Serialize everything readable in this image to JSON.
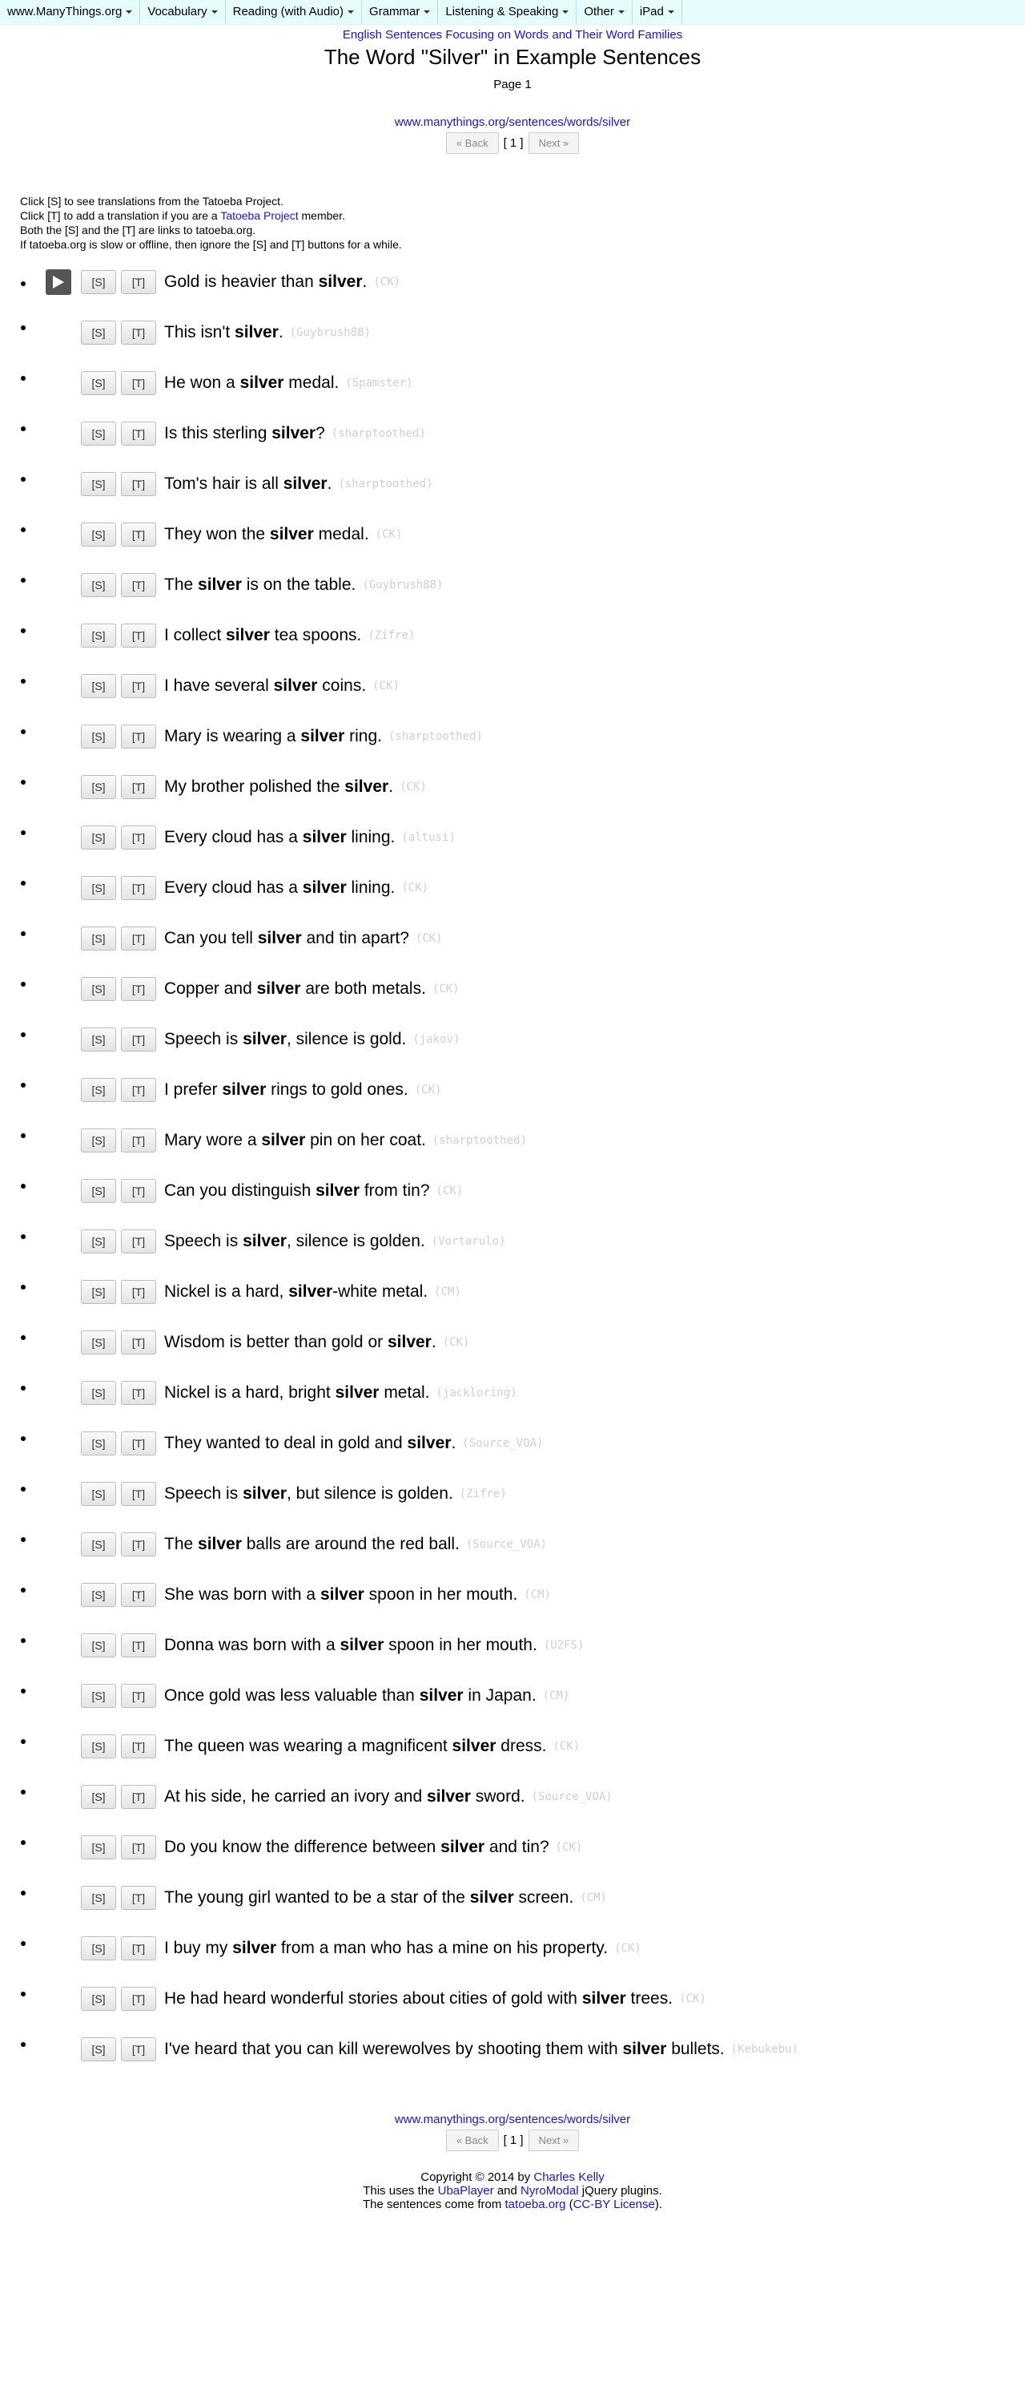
{
  "nav": {
    "items": [
      "www.ManyThings.org",
      "Vocabulary",
      "Reading (with Audio)",
      "Grammar",
      "Listening & Speaking",
      "Other",
      "iPad"
    ]
  },
  "header": {
    "subtitle": "English Sentences Focusing on Words and Their Word Families",
    "title": "The Word \"Silver\" in Example Sentences",
    "page": "Page 1",
    "url": "www.manythings.org/sentences/words/silver"
  },
  "pager": {
    "back": "« Back",
    "current": "[ 1 ]",
    "next": "Next »"
  },
  "notes": {
    "line1": "Click [S] to see translations from the Tatoeba Project.",
    "line2_pre": "Click [T] to add a translation if you are a ",
    "line2_link": "Tatoeba Project",
    "line2_post": " member.",
    "line3": "Both the [S] and the [T] are links to tatoeba.org.",
    "line4": "If tatoeba.org is slow or offline, then ignore the [S] and [T] buttons for a while."
  },
  "buttons": {
    "s": "[S]",
    "t": "[T]"
  },
  "sentences": [
    {
      "pre": "Gold is heavier than ",
      "word": "silver",
      "post": ".",
      "by": "(CK)"
    },
    {
      "pre": "This isn't ",
      "word": "silver",
      "post": ".",
      "by": "(Guybrush88)"
    },
    {
      "pre": "He won a ",
      "word": "silver",
      "post": " medal.",
      "by": "(Spamster)"
    },
    {
      "pre": "Is this sterling ",
      "word": "silver",
      "post": "?",
      "by": "(sharptoothed)"
    },
    {
      "pre": "Tom's hair is all ",
      "word": "silver",
      "post": ".",
      "by": "(sharptoothed)"
    },
    {
      "pre": "They won the ",
      "word": "silver",
      "post": " medal.",
      "by": "(CK)"
    },
    {
      "pre": "The ",
      "word": "silver",
      "post": " is on the table.",
      "by": "(Guybrush88)"
    },
    {
      "pre": "I collect ",
      "word": "silver",
      "post": " tea spoons.",
      "by": "(Zifre)"
    },
    {
      "pre": "I have several ",
      "word": "silver",
      "post": " coins.",
      "by": "(CK)"
    },
    {
      "pre": "Mary is wearing a ",
      "word": "silver",
      "post": " ring.",
      "by": "(sharptoothed)"
    },
    {
      "pre": "My brother polished the ",
      "word": "silver",
      "post": ".",
      "by": "(CK)"
    },
    {
      "pre": "Every cloud has a ",
      "word": "silver",
      "post": " lining.",
      "by": "(altusi)"
    },
    {
      "pre": "Every cloud has a ",
      "word": "silver",
      "post": " lining.",
      "by": "(CK)"
    },
    {
      "pre": "Can you tell ",
      "word": "silver",
      "post": " and tin apart?",
      "by": "(CK)"
    },
    {
      "pre": "Copper and ",
      "word": "silver",
      "post": " are both metals.",
      "by": "(CK)"
    },
    {
      "pre": "Speech is ",
      "word": "silver",
      "post": ", silence is gold.",
      "by": "(jakov)"
    },
    {
      "pre": "I prefer ",
      "word": "silver",
      "post": " rings to gold ones.",
      "by": "(CK)"
    },
    {
      "pre": "Mary wore a ",
      "word": "silver",
      "post": " pin on her coat.",
      "by": "(sharptoothed)"
    },
    {
      "pre": "Can you distinguish ",
      "word": "silver",
      "post": " from tin?",
      "by": "(CK)"
    },
    {
      "pre": "Speech is ",
      "word": "silver",
      "post": ", silence is golden.",
      "by": "(Vortarulo)"
    },
    {
      "pre": "Nickel is a hard, ",
      "word": "silver",
      "post": "-white metal.",
      "by": "(CM)"
    },
    {
      "pre": "Wisdom is better than gold or ",
      "word": "silver",
      "post": ".",
      "by": "(CK)"
    },
    {
      "pre": "Nickel is a hard, bright ",
      "word": "silver",
      "post": " metal.",
      "by": "(jackloring)"
    },
    {
      "pre": "They wanted to deal in gold and ",
      "word": "silver",
      "post": ".",
      "by": "(Source_VOA)"
    },
    {
      "pre": "Speech is ",
      "word": "silver",
      "post": ", but silence is golden.",
      "by": "(Zifre)"
    },
    {
      "pre": "The ",
      "word": "silver",
      "post": " balls are around the red ball.",
      "by": "(Source_VOA)"
    },
    {
      "pre": "She was born with a ",
      "word": "silver",
      "post": " spoon in her mouth.",
      "by": "(CM)"
    },
    {
      "pre": "Donna was born with a ",
      "word": "silver",
      "post": " spoon in her mouth.",
      "by": "(U2FS)"
    },
    {
      "pre": "Once gold was less valuable than ",
      "word": "silver",
      "post": " in Japan.",
      "by": "(CM)"
    },
    {
      "pre": "The queen was wearing a magnificent ",
      "word": "silver",
      "post": " dress.",
      "by": "(CK)"
    },
    {
      "pre": "At his side, he carried an ivory and ",
      "word": "silver",
      "post": " sword.",
      "by": "(Source_VOA)"
    },
    {
      "pre": "Do you know the difference between ",
      "word": "silver",
      "post": " and tin?",
      "by": "(CK)"
    },
    {
      "pre": "The young girl wanted to be a star of the ",
      "word": "silver",
      "post": " screen.",
      "by": "(CM)"
    },
    {
      "pre": "I buy my ",
      "word": "silver",
      "post": " from a man who has a mine on his property.",
      "by": "(CK)"
    },
    {
      "pre": "He had heard wonderful stories about cities of gold with ",
      "word": "silver",
      "post": " trees.",
      "by": "(CK)"
    },
    {
      "pre": "I've heard that you can kill werewolves by shooting them with ",
      "word": "silver",
      "post": " bullets.",
      "by": "(Kebukebu)"
    }
  ],
  "footer": {
    "url": "www.manythings.org/sentences/words/silver",
    "copyright_pre": "Copyright © 2014 by ",
    "copyright_link": "Charles Kelly",
    "uses_pre": "This uses the ",
    "uses_link1": "UbaPlayer",
    "uses_mid": " and ",
    "uses_link2": "NyroModal",
    "uses_post": " jQuery plugins.",
    "source_pre": "The sentences come from ",
    "source_link1": "tatoeba.org",
    "source_mid": " (",
    "source_link2": "CC-BY License",
    "source_post": ")."
  }
}
